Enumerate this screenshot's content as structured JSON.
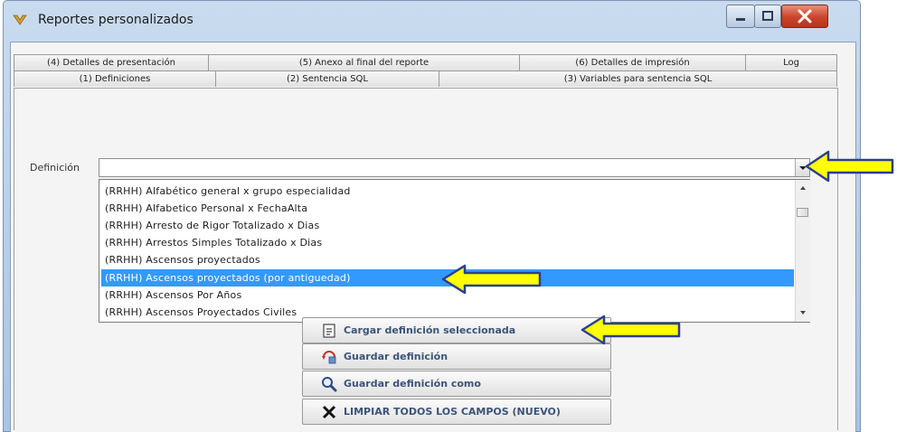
{
  "window": {
    "title": "Reportes personalizados"
  },
  "tabs": {
    "row_top": [
      "(4) Detalles de presentación",
      "(5) Anexo al final del reporte",
      "(6) Detalles de impresión",
      "Log"
    ],
    "row_bottom": [
      "(1) Definiciones",
      "(2) Sentencia SQL",
      "(3) Variables para sentencia SQL"
    ],
    "active": "(1) Definiciones"
  },
  "definicion": {
    "label": "Definición",
    "value": "",
    "options": [
      "(RRHH) Alfabético general x grupo especialidad",
      "(RRHH) Alfabetico Personal x FechaAlta",
      "(RRHH) Arresto de Rigor Totalizado x Dias",
      "(RRHH) Arrestos Simples Totalizado x Dias",
      "(RRHH) Ascensos proyectados",
      "(RRHH) Ascensos proyectados (por antiguedad)",
      "(RRHH) Ascensos Por Años",
      "(RRHH) Ascensos Proyectados Civiles"
    ],
    "selected_index": 5
  },
  "buttons": {
    "cargar": "Cargar definición seleccionada",
    "guardar": "Guardar definición",
    "guardar_como": "Guardar definición como",
    "limpiar": "LIMPIAR TODOS LOS CAMPOS (NUEVO)"
  },
  "colors": {
    "selection": "#3399ff",
    "arrow_fill": "#ffff00",
    "arrow_stroke": "#2b3f8f",
    "button_text": "#3c5478"
  }
}
